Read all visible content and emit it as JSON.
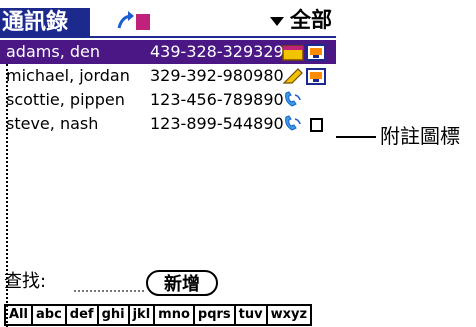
{
  "app": {
    "title": "通訊錄",
    "category": "全部"
  },
  "contacts": [
    {
      "name": "adams, den",
      "phone": "439-328-329329",
      "icons": [
        "calendar-icon",
        "contact-card-icon"
      ],
      "selected": true
    },
    {
      "name": "michael, jordan",
      "phone": "329-392-980980",
      "icons": [
        "pencil-icon",
        "contact-card-icon"
      ],
      "selected": false
    },
    {
      "name": "scottie, pippen",
      "phone": "123-456-789890",
      "icons": [
        "phone-handset-icon"
      ],
      "selected": false
    },
    {
      "name": "steve, nash",
      "phone": "123-899-544890",
      "icons": [
        "phone-handset-icon",
        "note-icon"
      ],
      "selected": false
    }
  ],
  "find": {
    "label": "查找:",
    "value": ""
  },
  "new_button": "新增",
  "alphabet": [
    "All",
    "abc",
    "def",
    "ghi",
    "jkl",
    "mno",
    "pqrs",
    "tuv",
    "wxyz"
  ],
  "callout": {
    "text": "附註圖標"
  },
  "colors": {
    "title_bg": "#1c2a8e",
    "selected_row_bg": "#4a1784"
  }
}
